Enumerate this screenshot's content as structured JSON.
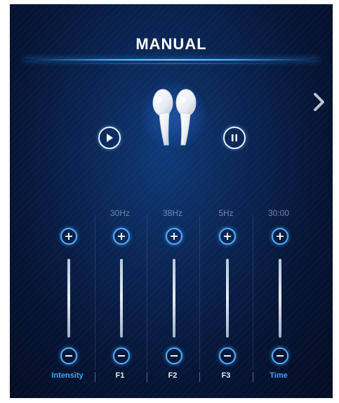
{
  "header": {
    "title": "MANUAL"
  },
  "nav": {
    "next_icon": "chevron-right-icon"
  },
  "transport": {
    "play_icon": "play-icon",
    "pause_icon": "pause-icon",
    "device_icon": "earbuds-icon"
  },
  "channels": [
    {
      "label": "Intensity",
      "value": "",
      "highlight": true
    },
    {
      "label": "F1",
      "value": "30Hz",
      "highlight": false
    },
    {
      "label": "F2",
      "value": "38Hz",
      "highlight": false
    },
    {
      "label": "F3",
      "value": "5Hz",
      "highlight": false
    },
    {
      "label": "Time",
      "value": "30:00",
      "highlight": true
    }
  ],
  "colors": {
    "accent": "#39a8ff",
    "background": "#0a2553",
    "text": "#ffffff",
    "value_text": "#6e86ad"
  }
}
